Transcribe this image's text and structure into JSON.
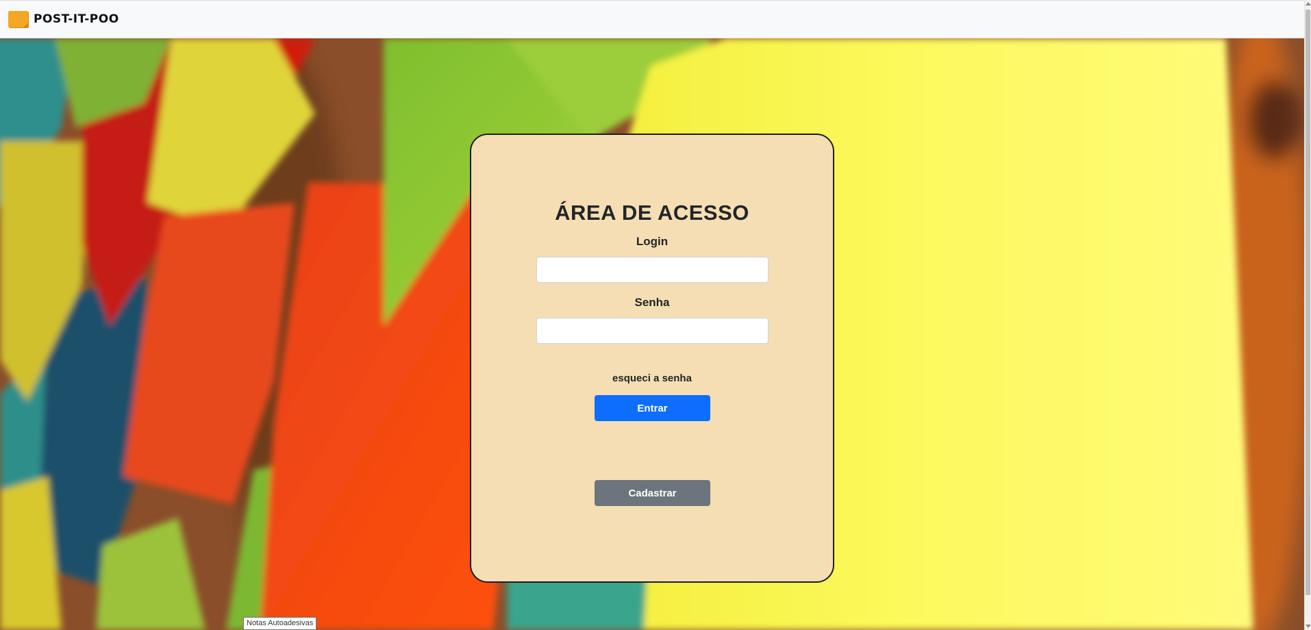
{
  "navbar": {
    "brand_text": "POST-IT-POO",
    "brand_icon": "sticky-note-icon"
  },
  "login": {
    "title": "ÁREA DE ACESSO",
    "login_label": "Login",
    "login_value": "",
    "senha_label": "Senha",
    "senha_value": "",
    "forgot_text": "esqueci a senha",
    "enter_button": "Entrar",
    "register_button": "Cadastrar"
  },
  "tooltip": {
    "text": "Notas Autoadesivas"
  },
  "colors": {
    "card_background": "#f5deb3",
    "primary_button": "#0d6efd",
    "secondary_button": "#6c757d",
    "navbar_background": "#f8f9fa"
  }
}
